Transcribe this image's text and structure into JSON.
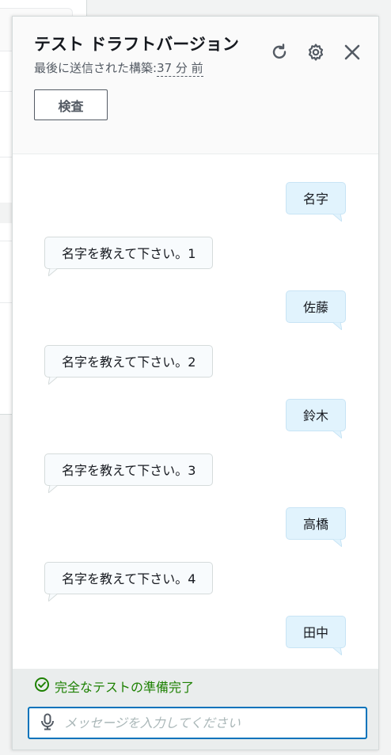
{
  "panel": {
    "title": "テスト ドラフトバージョン",
    "subtitle_prefix": "最後に送信された構築:",
    "subtitle_time": "37 分 前",
    "inspect_button": "検査",
    "icons": {
      "refresh": "refresh-icon",
      "settings": "gear-icon",
      "close": "close-icon"
    }
  },
  "chat": {
    "messages": [
      {
        "role": "user",
        "text": "名字"
      },
      {
        "role": "bot",
        "text": "名字を教えて下さい。1"
      },
      {
        "role": "user",
        "text": "佐藤"
      },
      {
        "role": "bot",
        "text": "名字を教えて下さい。2"
      },
      {
        "role": "user",
        "text": "鈴木"
      },
      {
        "role": "bot",
        "text": "名字を教えて下さい。3"
      },
      {
        "role": "user",
        "text": "高橋"
      },
      {
        "role": "bot",
        "text": "名字を教えて下さい。4"
      },
      {
        "role": "user",
        "text": "田中"
      }
    ]
  },
  "footer": {
    "status_text": "完全なテストの準備完了",
    "status_color": "#1d8102",
    "input_placeholder": "メッセージを入力してください",
    "input_value": "",
    "mic_icon": "microphone-icon"
  },
  "colors": {
    "accent": "#0073bb",
    "user_bubble": "#e1f3fd",
    "bot_bubble": "#f8fbfd"
  }
}
